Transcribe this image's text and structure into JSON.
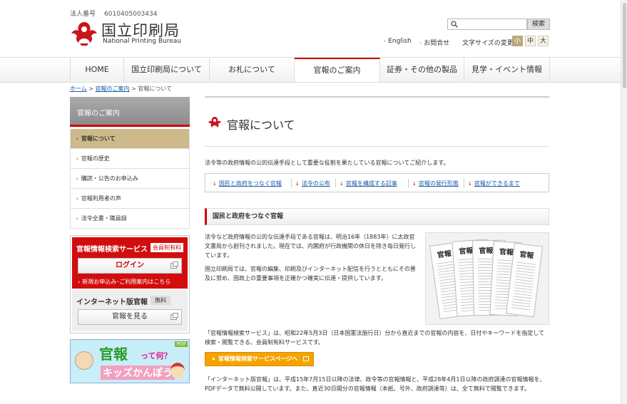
{
  "header": {
    "corp_no_label": "法人番号",
    "corp_no_value": "6010405003434",
    "logo_jp": "国立印刷局",
    "logo_en": "National Printing Bureau",
    "search_placeholder": "",
    "search_button": "検索",
    "link_english": "English",
    "link_contact": "お問合せ",
    "font_size_label": "文字サイズの変更",
    "font_small": "小",
    "font_mid": "中",
    "font_large": "大"
  },
  "gnav": [
    {
      "label": "HOME"
    },
    {
      "label": "国立印刷局について"
    },
    {
      "label": "お札について"
    },
    {
      "label": "官報のご案内"
    },
    {
      "label": "証券・その他の製品"
    },
    {
      "label": "見学・イベント情報"
    }
  ],
  "breadcrumb": {
    "home": "ホーム",
    "sep": ">",
    "parent": "官報のご案内",
    "current": "官報について"
  },
  "side": {
    "heading": "官報のご案内",
    "items": [
      {
        "label": "官報について"
      },
      {
        "label": "官報の歴史"
      },
      {
        "label": "購読・公告のお申込み"
      },
      {
        "label": "官報利用者の声"
      },
      {
        "label": "法令全書・職員録"
      }
    ]
  },
  "search_panel": {
    "title": "官報情報検索サービス",
    "badge": "会員制有料",
    "login": "ログイン",
    "link": "新規お申込み･ご利用案内はこちら",
    "net_title": "インターネット版官報",
    "net_badge": "無料",
    "net_button": "官報を見る"
  },
  "kids_banner": {
    "title": "官報",
    "sub": "って何？",
    "sub2": "キッズかんぽう",
    "pdf": "PDF"
  },
  "main": {
    "title": "官報について",
    "intro": "法令等の政府情報の公的伝達手段として重要な役割を果たしている官報についてご紹介します。",
    "anchors": [
      {
        "label": "国民と政府をつなぐ官報"
      },
      {
        "label": "法令の公布"
      },
      {
        "label": "官報を構成する記事"
      },
      {
        "label": "官報の発行形態"
      },
      {
        "label": "官報ができるまで"
      }
    ],
    "section_title": "国民と政府をつなぐ官報",
    "para1": "法令など政府情報の公的な伝達手段である官報は、明治16年（1883年）に太政官文書局から創刊されました。現在では、内閣府が行政機関の休日を除き毎日発行しています。",
    "para2": "国立印刷局では、官報の編集、印刷及びインターネット配信を行うとともにその普及に努め、国政上の重要事項を正確かつ確実に伝達・提供しています。",
    "photo_mast": "官報",
    "para3": "「官報情報検索サービス」は、昭和22年5月3日（日本国憲法施行日）分から直近までの官報の内容を、日付やキーワードを指定して検索・閲覧できる、会員制有料サービスです。",
    "orange_btn": "官報情報検索サービスページへ",
    "para4": "「インターネット版官報」は、平成15年7月15日以降の法律、政令等の官報情報と、平成28年4月1日以降の政府調達の官報情報を、PDFデータで無料公開しています。また、直近30日間分の官報情報（本紙、号外、政府調達等）は、全て無料で閲覧できます。"
  },
  "colors": {
    "accent_red": "#cc0000",
    "side_active": "#cdb98a",
    "orange": "#f4a300",
    "link_blue": "#1a5aa8"
  }
}
